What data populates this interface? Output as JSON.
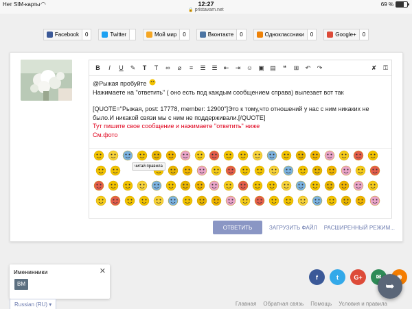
{
  "status": {
    "carrier": "Нет SIM-карты",
    "time": "12:27",
    "url": "pristavam.net",
    "battery": "69 %",
    "battery_level": 69
  },
  "share": [
    {
      "label": "Facebook",
      "count": "0",
      "color": "#3b5998",
      "icon": "facebook-icon"
    },
    {
      "label": "Twitter",
      "count": "",
      "color": "#1da1f2",
      "icon": "twitter-icon"
    },
    {
      "label": "Мой мир",
      "count": "0",
      "color": "#f5a623",
      "icon": "moimir-icon"
    },
    {
      "label": "Вконтакте",
      "count": "0",
      "color": "#4c75a3",
      "icon": "vk-icon"
    },
    {
      "label": "Одноклассники",
      "count": "0",
      "color": "#ee8208",
      "icon": "ok-icon"
    },
    {
      "label": "Google+",
      "count": "0",
      "color": "#dd4b39",
      "icon": "googleplus-icon"
    }
  ],
  "editor": {
    "line1": "@Рыжая  пробуйте",
    "line2": "Нажимаете на  \"ответить\" ( оно есть под каждым сообщением справа) вылезает вот так",
    "line3": "[QUOTE=\"Рыжая, post: 17778, member: 12900\"]Это к тому,что отношений у нас с ним никаких не было.И никакой связи мы с ним не поддерживали.[/QUOTE]",
    "line4": "Тут пишите свое сообщение и нажимаете \"ответить\" ниже",
    "line5": "См.фото",
    "tooltip": "читай правила"
  },
  "actions": {
    "reply": "ОТВЕТИТЬ",
    "upload": "ЗАГРУЗИТЬ ФАЙЛ",
    "advanced": "РАСШИРЕННЫЙ РЕЖИМ..."
  },
  "birthday": {
    "title": "Именинники",
    "initials": "BM"
  },
  "social_colors": [
    "#3b5998",
    "#33a9e9",
    "#dd4b39",
    "#2e8b57",
    "#f57d00"
  ],
  "footer": {
    "language": "Russian (RU)",
    "links": [
      "Главная",
      "Обратная связь",
      "Помощь",
      "Условия и правила"
    ]
  },
  "colors": {
    "red": "#e0001b",
    "accent": "#8a96c4",
    "link": "#6e7db0"
  }
}
